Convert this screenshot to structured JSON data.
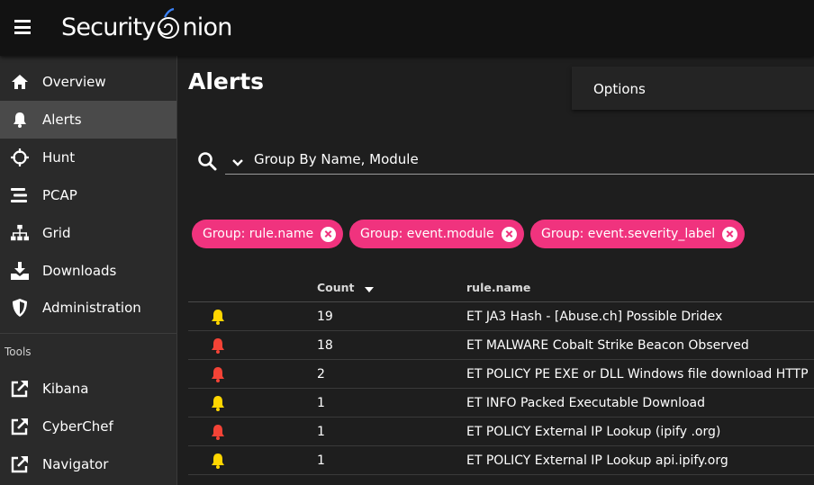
{
  "app": {
    "logo_left": "Security",
    "logo_right": "nion"
  },
  "sidebar": {
    "items": [
      {
        "label": "Overview",
        "icon": "home-icon"
      },
      {
        "label": "Alerts",
        "icon": "bell-icon",
        "active": true
      },
      {
        "label": "Hunt",
        "icon": "crosshairs-icon"
      },
      {
        "label": "PCAP",
        "icon": "stream-icon"
      },
      {
        "label": "Grid",
        "icon": "sitemap-icon"
      },
      {
        "label": "Downloads",
        "icon": "download-icon"
      },
      {
        "label": "Administration",
        "icon": "shield-icon"
      }
    ],
    "tools_label": "Tools",
    "tools": [
      {
        "label": "Kibana",
        "icon": "external-link-icon"
      },
      {
        "label": "CyberChef",
        "icon": "external-link-icon"
      },
      {
        "label": "Navigator",
        "icon": "external-link-icon"
      }
    ]
  },
  "main": {
    "title": "Alerts",
    "options_label": "Options",
    "query_value": "Group By Name, Module",
    "chips": [
      {
        "label": "Group: rule.name"
      },
      {
        "label": "Group: event.module"
      },
      {
        "label": "Group: event.severity_label"
      }
    ],
    "table": {
      "headers": {
        "count": "Count",
        "name": "rule.name"
      },
      "sort": "descending",
      "rows": [
        {
          "severity": "medium",
          "count": "19",
          "name": "ET JA3 Hash - [Abuse.ch] Possible Dridex"
        },
        {
          "severity": "high",
          "count": "18",
          "name": "ET MALWARE Cobalt Strike Beacon Observed"
        },
        {
          "severity": "high",
          "count": "2",
          "name": "ET POLICY PE EXE or DLL Windows file download HTTP"
        },
        {
          "severity": "medium",
          "count": "1",
          "name": "ET INFO Packed Executable Download"
        },
        {
          "severity": "high",
          "count": "1",
          "name": "ET POLICY External IP Lookup (ipify .org)"
        },
        {
          "severity": "medium",
          "count": "1",
          "name": "ET POLICY External IP Lookup api.ipify.org"
        }
      ]
    }
  },
  "colors": {
    "accent_chip": "#f0337e",
    "severity_medium": "#ffd600",
    "severity_high": "#f44336"
  }
}
